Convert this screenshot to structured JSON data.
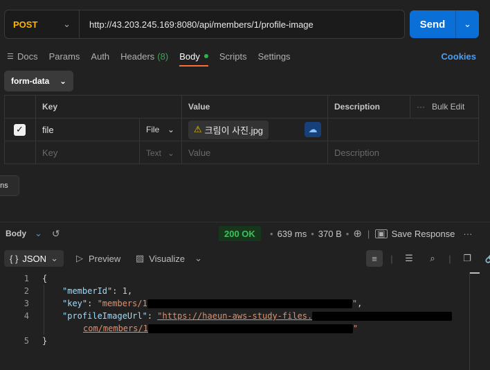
{
  "request": {
    "method": "POST",
    "url": "http://43.203.245.169:8080/api/members/1/profile-image",
    "send_label": "Send"
  },
  "tabs": [
    {
      "label": "Docs"
    },
    {
      "label": "Params"
    },
    {
      "label": "Auth"
    },
    {
      "label": "Headers",
      "count": "(8)"
    },
    {
      "label": "Body",
      "active": true
    },
    {
      "label": "Scripts"
    },
    {
      "label": "Settings"
    }
  ],
  "cookies_label": "Cookies",
  "body_mode": "form-data",
  "table": {
    "headers": {
      "key": "Key",
      "value": "Value",
      "description": "Description",
      "bulk_edit": "Bulk Edit"
    },
    "rows": [
      {
        "checked": true,
        "key": "file",
        "type": "File",
        "value": "크림이 사진.jpg",
        "description": ""
      }
    ],
    "placeholder": {
      "key": "Key",
      "type": "Text",
      "value": "Value",
      "description": "Description"
    }
  },
  "tooltip_text": "ons",
  "response": {
    "title": "Body",
    "status": "200 OK",
    "time": "639 ms",
    "size": "370 B",
    "save_label": "Save Response",
    "format": "JSON",
    "preview_label": "Preview",
    "visualize_label": "Visualize"
  },
  "code": {
    "line_numbers": [
      "1",
      "2",
      "3",
      "4",
      "5"
    ],
    "open_brace": "{",
    "close_brace": "}",
    "member_key": "\"memberId\"",
    "member_val": "1",
    "key_key": "\"key\"",
    "key_val_prefix": "\"members/1",
    "key_val_suffix": "\"",
    "url_key": "\"profileImageUrl\"",
    "url_val_prefix": "\"https://haeun-aws-study-files.",
    "url_val_cont": "com/members/1",
    "url_val_suffix": "\""
  }
}
